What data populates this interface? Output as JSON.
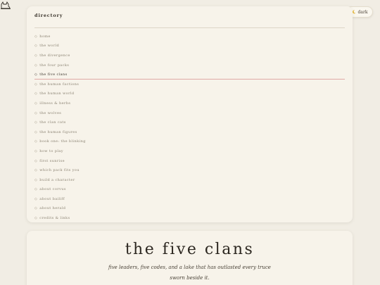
{
  "theme_toggle": {
    "label": "dark",
    "icon": "moon-icon"
  },
  "directory": {
    "title": "directory",
    "active_index": 4,
    "items": [
      "home",
      "the world",
      "the divergence",
      "the four packs",
      "the five clans",
      "the human factions",
      "the human world",
      "illness & herbs",
      "the wolves",
      "the clan cats",
      "the human figures",
      "book one: the blinking",
      "how to play",
      "first sunrise",
      "which pack fits you",
      "build a character",
      "about corvus",
      "about bailiff",
      "about herald",
      "credits & links"
    ]
  },
  "hero": {
    "title": "the five clans",
    "subtitle": "five leaders, five codes, and a lake that has outlasted every truce sworn beside it."
  },
  "colors": {
    "background": "#f1ede4",
    "card": "#f7f3ea",
    "active_underline": "#e0a9a4"
  }
}
